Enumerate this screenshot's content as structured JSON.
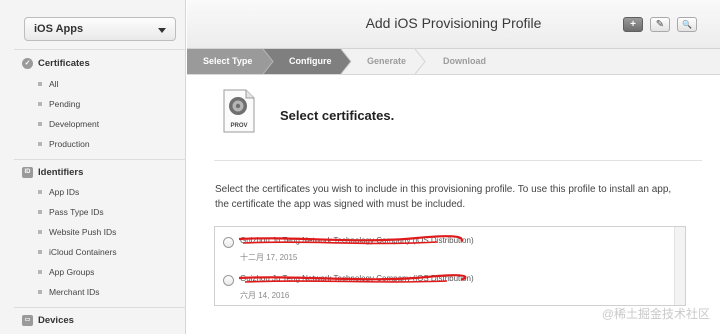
{
  "sidebar": {
    "app_selector": "iOS Apps",
    "certificates": {
      "title": "Certificates",
      "items": [
        "All",
        "Pending",
        "Development",
        "Production"
      ]
    },
    "identifiers": {
      "badge": "ID",
      "title": "Identifiers",
      "items": [
        "App IDs",
        "Pass Type IDs",
        "Website Push IDs",
        "iCloud Containers",
        "App Groups",
        "Merchant IDs"
      ]
    },
    "devices": {
      "title": "Devices"
    }
  },
  "header": {
    "title": "Add iOS Provisioning Profile",
    "add_button": "+",
    "edit_button": "✎",
    "search_button": "🔍"
  },
  "steps": [
    "Select Type",
    "Configure",
    "Generate",
    "Download"
  ],
  "main": {
    "icon_label": "PROV",
    "heading": "Select certificates.",
    "description": "Select the certificates you wish to include in this provisioning profile. To use this profile to install an app, the certificate the app was signed with must be included.",
    "certificates": [
      {
        "name": "Guizhou Ju Teng Network Technology Company",
        "type": "(iOS Distribution)",
        "date": "十二月 17, 2015"
      },
      {
        "name": "Guizhou Ju Teng Network Technology Company",
        "type": "(iOS Distribution)",
        "date": "六月 14, 2016"
      }
    ]
  },
  "watermark": "@稀土掘金技术社区",
  "colors": {
    "step_active": "#8a8a8a",
    "step_inactive": "#f2f2f2",
    "redaction": "#e01a1a"
  }
}
